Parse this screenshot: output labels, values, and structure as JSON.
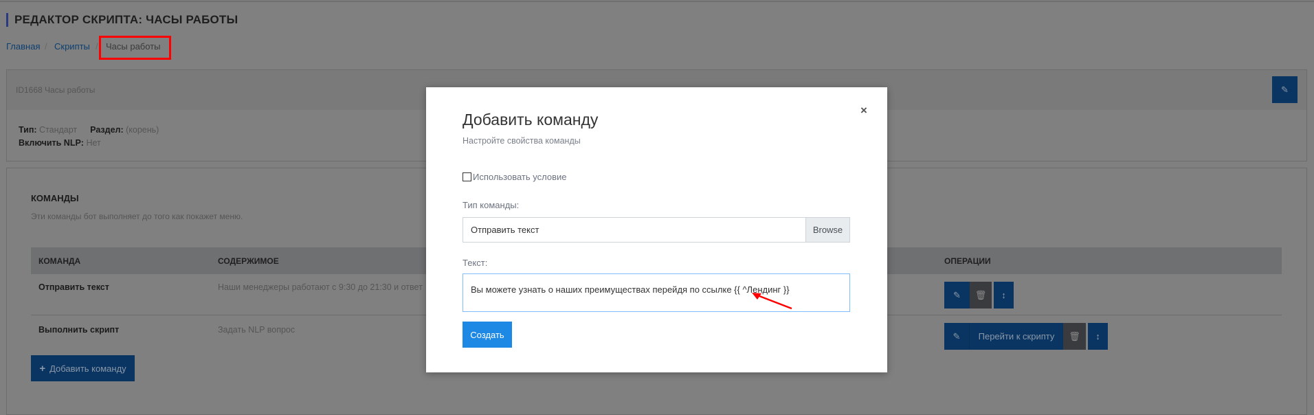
{
  "page": {
    "title": "РЕДАКТОР СКРИПТА: ЧАСЫ РАБОТЫ",
    "breadcrumb": [
      "Главная",
      "Скрипты",
      "Часы работы"
    ],
    "breadcrumb_separator": "/"
  },
  "script_panel": {
    "header": "ID1668 Часы работы",
    "type_label": "Тип:",
    "type_value": "Стандарт",
    "section_label": "Раздел:",
    "section_value": "(корень)",
    "nlp_label": "Включить NLP:",
    "nlp_value": "Нет",
    "edit_icon": "edit-icon"
  },
  "commands": {
    "title": "КОМАНДЫ",
    "description": "Эти команды бот выполняет до того как покажет меню.",
    "columns": [
      "КОМАНДА",
      "СОДЕРЖИМОЕ",
      "ОПЕРАЦИИ"
    ],
    "rows": [
      {
        "command": "Отправить текст",
        "content": "Наши менеджеры работают с 9:30 до 21:30 и ответ"
      },
      {
        "command": "Выполнить скрипт",
        "content": "Задать NLP вопрос",
        "goto_label": "Перейти к скрипту"
      }
    ],
    "add_button": "Добавить команду"
  },
  "modal": {
    "title": "Добавить команду",
    "subtitle": "Настройте свойства команды",
    "close": "×",
    "use_condition_label": "Использовать условие",
    "use_condition_checked": false,
    "type_label": "Тип команды:",
    "type_value": "Отправить текст",
    "browse_label": "Browse",
    "text_label": "Текст:",
    "text_value": "Вы можете узнать о наших преимуществах перейдя по ссылке {{ ^Лендинг }}",
    "submit_label": "Создать"
  },
  "colors": {
    "primary": "#0a3461",
    "modal_button": "#1e88e5",
    "annotation": "#ff0000",
    "overlay": "#808080"
  }
}
